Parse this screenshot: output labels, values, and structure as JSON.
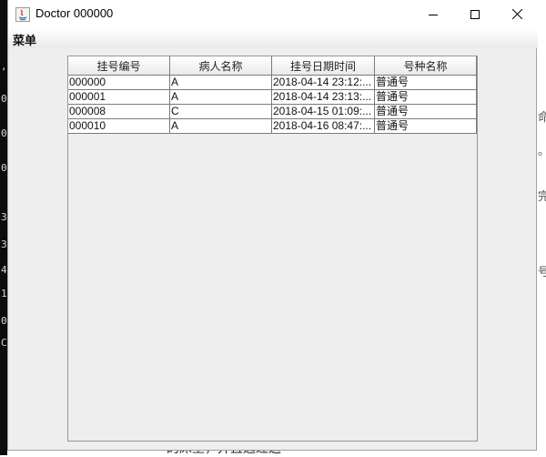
{
  "window": {
    "title": "Doctor 000000"
  },
  "menu": {
    "label": "菜单"
  },
  "table": {
    "columns": [
      "挂号编号",
      "病人名称",
      "挂号日期时间",
      "号种名称"
    ],
    "rows": [
      [
        "000000",
        "A",
        "2018-04-14 23:12:...",
        "普通号"
      ],
      [
        "000001",
        "A",
        "2018-04-14 23:13:...",
        "普通号"
      ],
      [
        "000008",
        "C",
        "2018-04-15 01:09:...",
        "普通号"
      ],
      [
        "000010",
        "A",
        "2018-04-16 08:47:...",
        "普通号"
      ]
    ]
  },
  "background": {
    "left_glyphs": [
      ",",
      "0.",
      "0",
      "0",
      "3",
      "3",
      "4",
      "1",
      "0",
      "C"
    ],
    "right_glyphs": [
      "命",
      "。",
      "完",
      "号"
    ],
    "bottom_text": "的床垫，并且通过迦"
  }
}
